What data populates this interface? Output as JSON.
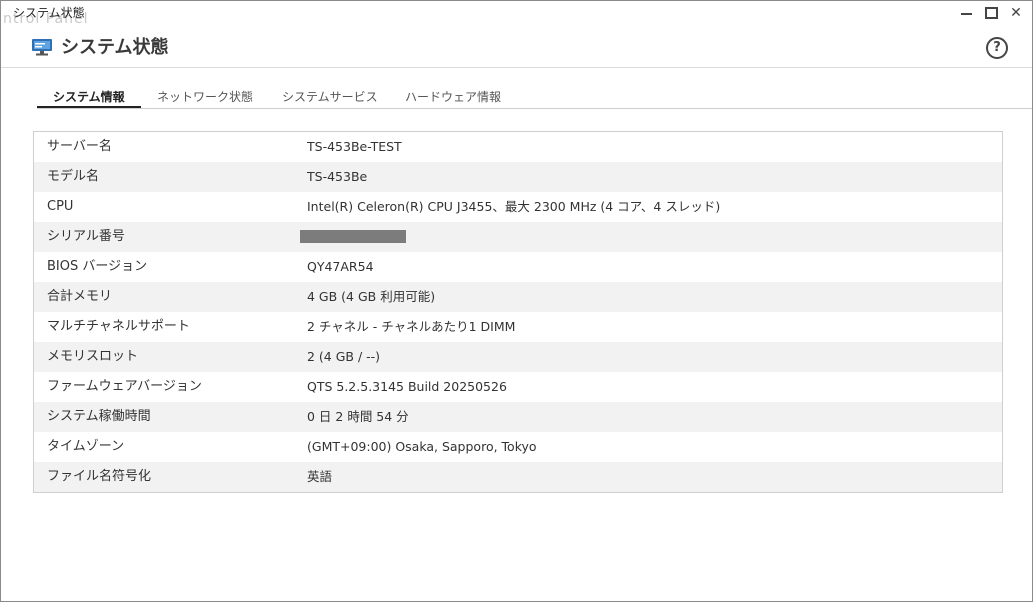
{
  "window": {
    "titlebar_label": "システム状態",
    "ghost_text": "ntrol Panel"
  },
  "header": {
    "title": "システム状態",
    "help": "?"
  },
  "tabs": [
    {
      "label": "システム情報",
      "active": true
    },
    {
      "label": "ネットワーク状態",
      "active": false
    },
    {
      "label": "システムサービス",
      "active": false
    },
    {
      "label": "ハードウェア情報",
      "active": false
    }
  ],
  "rows": [
    {
      "label": "サーバー名",
      "value": "TS-453Be-TEST"
    },
    {
      "label": "モデル名",
      "value": "TS-453Be"
    },
    {
      "label": "CPU",
      "value": "Intel(R) Celeron(R) CPU J3455、最大 2300 MHz (4 コア、4 スレッド)"
    },
    {
      "label": "シリアル番号",
      "value": ""
    },
    {
      "label": "BIOS バージョン",
      "value": "QY47AR54"
    },
    {
      "label": "合計メモリ",
      "value": "4 GB (4 GB 利用可能)"
    },
    {
      "label": "マルチチャネルサポート",
      "value": "2 チャネル - チャネルあたり1 DIMM"
    },
    {
      "label": "メモリスロット",
      "value": "2 (4 GB / --)"
    },
    {
      "label": "ファームウェアバージョン",
      "value": "QTS 5.2.5.3145 Build 20250526"
    },
    {
      "label": "システム稼働時間",
      "value": "0 日 2 時間 54 分"
    },
    {
      "label": "タイムゾーン",
      "value": "(GMT+09:00) Osaka, Sapporo, Tokyo"
    },
    {
      "label": "ファイル名符号化",
      "value": "英語"
    }
  ]
}
